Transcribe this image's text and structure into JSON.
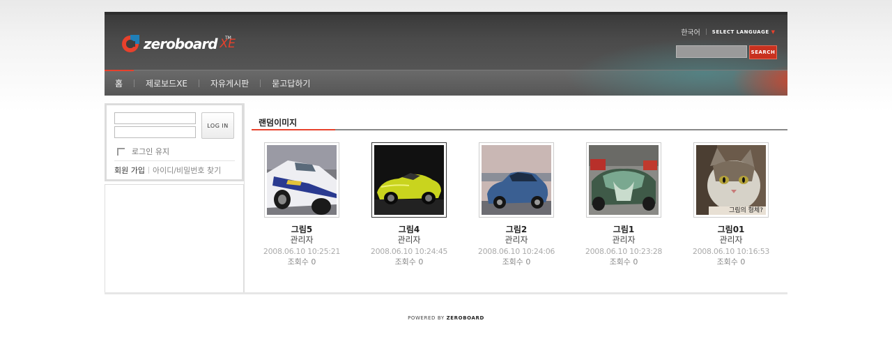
{
  "brand": {
    "logo_text": "zeroboard",
    "logo_suffix": "XE",
    "logo_tm": "TM"
  },
  "header": {
    "current_language": "한국어",
    "select_language": "SELECT LANGUAGE",
    "search_placeholder": "",
    "search_button": "SEARCH"
  },
  "nav": [
    {
      "label": "홈"
    },
    {
      "label": "제로보드XE"
    },
    {
      "label": "자유게시판"
    },
    {
      "label": "묻고답하기"
    }
  ],
  "login": {
    "button": "LOG IN",
    "keep_login": "로그인 유지",
    "join": "회원 가입",
    "find": "아이디/비밀번호 찾기"
  },
  "section_title": "랜덤이미지",
  "gallery": [
    {
      "title": "그림5",
      "author": "관리자",
      "date": "2008.06.10 10:25:21",
      "views": "조회수 0",
      "image": "police-car"
    },
    {
      "title": "그림4",
      "author": "관리자",
      "date": "2008.06.10 10:24:45",
      "views": "조회수 0",
      "image": "yellow-convertible"
    },
    {
      "title": "그림2",
      "author": "관리자",
      "date": "2008.06.10 10:24:06",
      "views": "조회수 0",
      "image": "blue-sedan"
    },
    {
      "title": "그림1",
      "author": "관리자",
      "date": "2008.06.10 10:23:28",
      "views": "조회수 0",
      "image": "dragon-car"
    },
    {
      "title": "그림01",
      "author": "관리자",
      "date": "2008.06.10 10:16:53",
      "views": "조회수 0",
      "image": "cat",
      "caption": "그림의 형체?"
    }
  ],
  "footer": {
    "powered_by": "POWERED BY",
    "brand": "ZEROBOARD"
  }
}
